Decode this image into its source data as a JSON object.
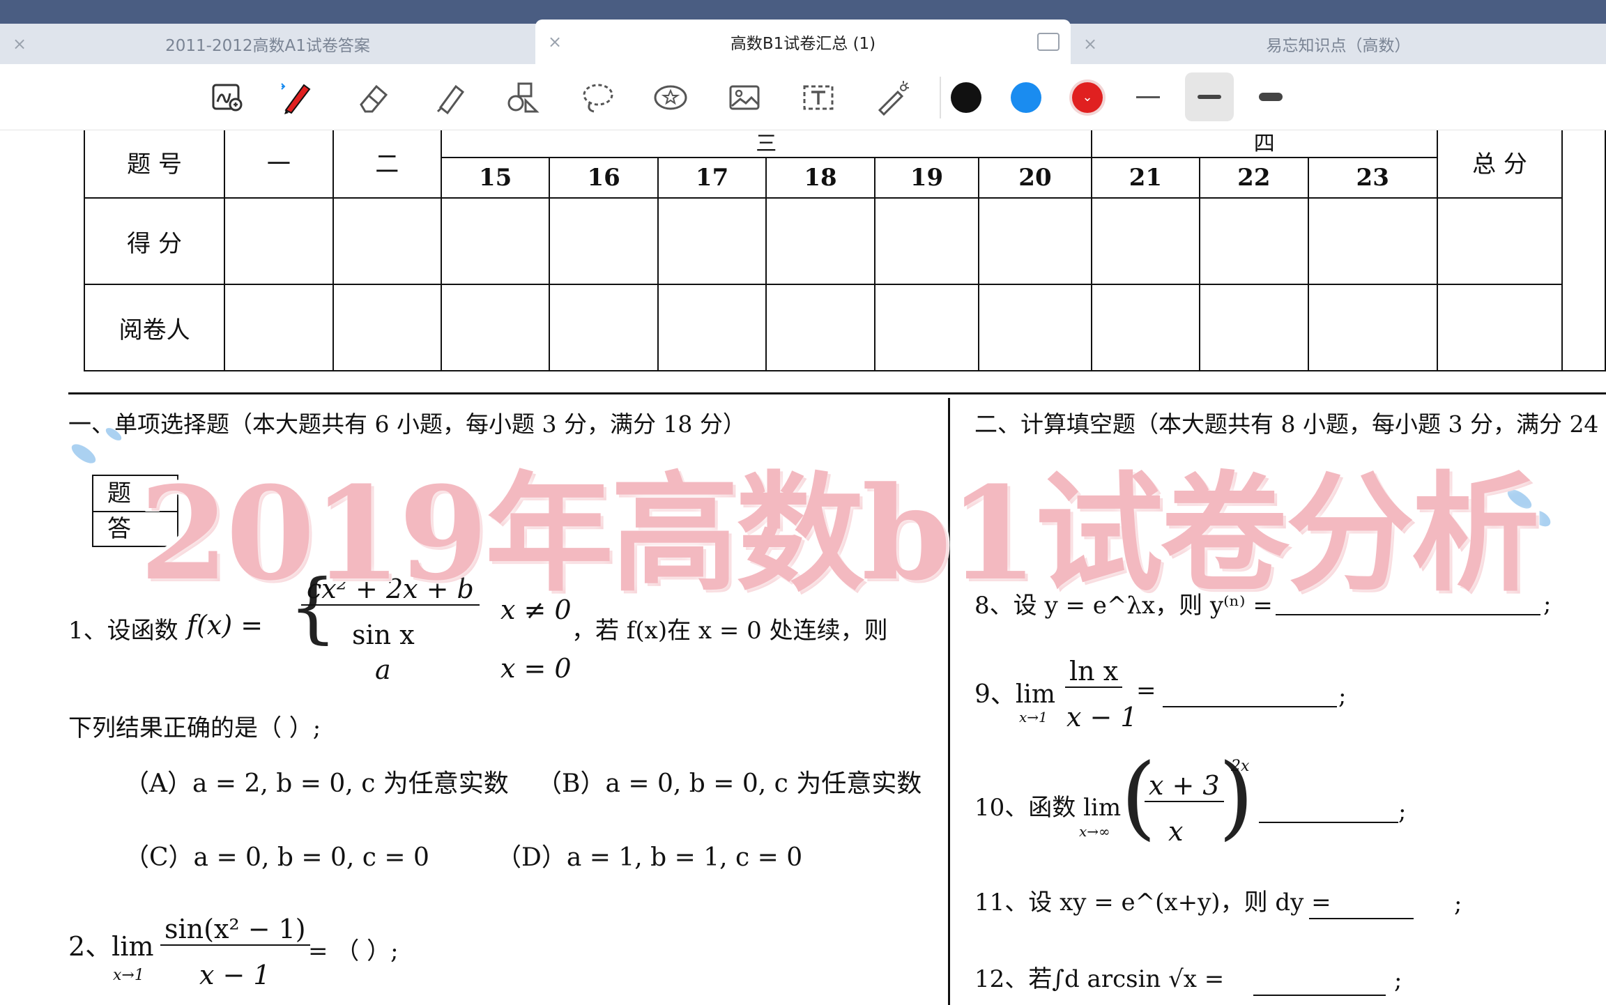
{
  "tabs": [
    {
      "label": "2011-2012高数A1试卷答案",
      "active": false
    },
    {
      "label": "高数B1试卷汇总 (1)",
      "active": true
    },
    {
      "label": "易忘知识点（高数）",
      "active": false
    }
  ],
  "toolbar": {
    "tools": [
      "zoom-ink-icon",
      "pen-icon",
      "eraser-icon",
      "highlighter-icon",
      "shapes-icon",
      "lasso-icon",
      "sticker-icon",
      "image-icon",
      "text-icon",
      "laser-pointer-icon"
    ],
    "colors": [
      "#111111",
      "#1a8cf0",
      "#e02020"
    ],
    "selected_color": "#e02020"
  },
  "score_table": {
    "row_labels": [
      "题 号",
      "得 分",
      "阅卷人"
    ],
    "section_labels": [
      "一",
      "二",
      "三",
      "四"
    ],
    "question_numbers_three": [
      "15",
      "16",
      "17",
      "18",
      "19",
      "20"
    ],
    "question_numbers_four": [
      "21",
      "22",
      "23"
    ],
    "total_label": "总 分"
  },
  "section1": {
    "heading": "一、单项选择题（本大题共有 6 小题，每小题 3 分，满分 18 分）",
    "answer_row_labels": [
      "题",
      "答"
    ],
    "q1_prefix": "1、设函数",
    "q1_func": "f(x) =",
    "q1_num": "cx² + 2x + b",
    "q1_den": "sin x",
    "q1_case_a": "a",
    "q1_cond1": "x ≠ 0",
    "q1_cond2": "x = 0",
    "q1_suffix": "，若 f(x)在 x = 0 处连续，则",
    "q1_tail": "下列结果正确的是（                    ）;",
    "opt_a": "（A）a = 2, b = 0,  c 为任意实数",
    "opt_b": "（B）a = 0, b = 0,   c  为任意实数",
    "opt_c": "（C）a = 0, b = 0, c = 0",
    "opt_d": "（D）a = 1, b = 1, c = 0",
    "q2_prefix": "2、lim",
    "q2_sub": "x→1",
    "q2_num": "sin(x² − 1)",
    "q2_den": "x − 1",
    "q2_tail": "= （                    ）;"
  },
  "section2": {
    "heading": "二、计算填空题（本大题共有 8 小题，每小题 3 分，满分 24",
    "q8": "8、设 y = e^λx，则 y⁽ⁿ⁾ =",
    "q9_prefix": "9、lim",
    "q9_sub": "x→1",
    "q9_num": "ln x",
    "q9_den": "x − 1",
    "q10_prefix": "10、函数 lim",
    "q10_sub": "x→∞",
    "q10_num": "x + 3",
    "q10_den": "x",
    "q10_exp": "2x",
    "q11": "11、设 xy = e^(x+y)，则 dy =",
    "q12": "12、若∫d arcsin √x ="
  },
  "overlay_title": "2019年高数b1试卷分析"
}
